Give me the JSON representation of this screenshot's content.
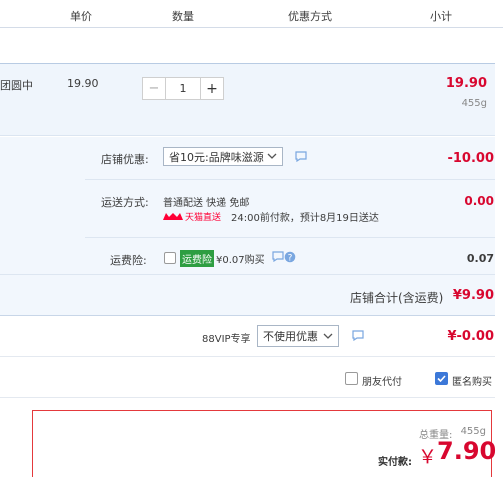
{
  "header": {
    "col_unit_price": "单价",
    "col_quantity": "数量",
    "col_discount": "优惠方式",
    "col_subtotal": "小计"
  },
  "item": {
    "status": "团圆中",
    "unit_price": "19.90",
    "quantity": "1",
    "minus": "−",
    "plus": "+",
    "subtotal": "19.90",
    "weight": "455g"
  },
  "shop_discount": {
    "label": "店铺优惠:",
    "selected": "省10元:品牌味滋源",
    "amount": "-10.00"
  },
  "shipping": {
    "label": "运送方式:",
    "method": "普通配送 快递 免邮",
    "amount": "0.00",
    "carrier_badge": "天猫直送",
    "delivery_note": "24:00前付款，预计8月19日送达"
  },
  "insurance": {
    "label": "运费险:",
    "badge": "运费险",
    "price_note": "¥0.07购买",
    "amount": "0.07"
  },
  "shop_total": {
    "label": "店铺合计(含运费)",
    "amount": "¥9.90"
  },
  "vip": {
    "label": "88VIP专享",
    "selected": "不使用优惠",
    "amount": "¥-0.00"
  },
  "options": {
    "friend_pay": "朋友代付",
    "anonymous": "匿名购买",
    "anonymous_checked": true,
    "friend_checked": false
  },
  "summary": {
    "weight_label": "总重量:",
    "weight": "455g",
    "pay_label": "实付款:",
    "currency": "￥",
    "total": "7.90"
  },
  "colors": {
    "accent_red": "#d8072f",
    "blue": "#3c78d8",
    "badge_green": "#2e9e42",
    "tmall_red": "#ff0036"
  }
}
